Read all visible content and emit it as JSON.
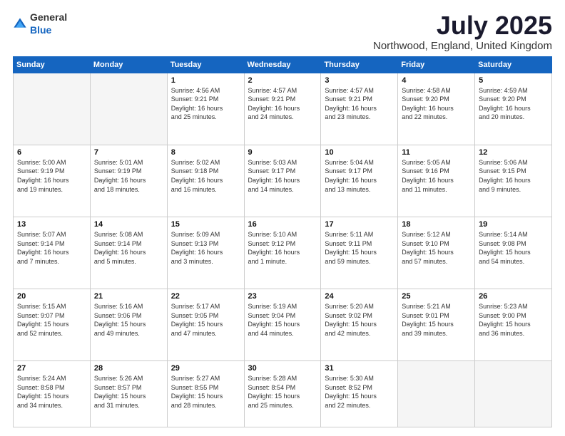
{
  "header": {
    "logo_general": "General",
    "logo_blue": "Blue",
    "title": "July 2025",
    "subtitle": "Northwood, England, United Kingdom"
  },
  "calendar": {
    "days_of_week": [
      "Sunday",
      "Monday",
      "Tuesday",
      "Wednesday",
      "Thursday",
      "Friday",
      "Saturday"
    ],
    "weeks": [
      [
        {
          "day": "",
          "info": ""
        },
        {
          "day": "",
          "info": ""
        },
        {
          "day": "1",
          "info": "Sunrise: 4:56 AM\nSunset: 9:21 PM\nDaylight: 16 hours\nand 25 minutes."
        },
        {
          "day": "2",
          "info": "Sunrise: 4:57 AM\nSunset: 9:21 PM\nDaylight: 16 hours\nand 24 minutes."
        },
        {
          "day": "3",
          "info": "Sunrise: 4:57 AM\nSunset: 9:21 PM\nDaylight: 16 hours\nand 23 minutes."
        },
        {
          "day": "4",
          "info": "Sunrise: 4:58 AM\nSunset: 9:20 PM\nDaylight: 16 hours\nand 22 minutes."
        },
        {
          "day": "5",
          "info": "Sunrise: 4:59 AM\nSunset: 9:20 PM\nDaylight: 16 hours\nand 20 minutes."
        }
      ],
      [
        {
          "day": "6",
          "info": "Sunrise: 5:00 AM\nSunset: 9:19 PM\nDaylight: 16 hours\nand 19 minutes."
        },
        {
          "day": "7",
          "info": "Sunrise: 5:01 AM\nSunset: 9:19 PM\nDaylight: 16 hours\nand 18 minutes."
        },
        {
          "day": "8",
          "info": "Sunrise: 5:02 AM\nSunset: 9:18 PM\nDaylight: 16 hours\nand 16 minutes."
        },
        {
          "day": "9",
          "info": "Sunrise: 5:03 AM\nSunset: 9:17 PM\nDaylight: 16 hours\nand 14 minutes."
        },
        {
          "day": "10",
          "info": "Sunrise: 5:04 AM\nSunset: 9:17 PM\nDaylight: 16 hours\nand 13 minutes."
        },
        {
          "day": "11",
          "info": "Sunrise: 5:05 AM\nSunset: 9:16 PM\nDaylight: 16 hours\nand 11 minutes."
        },
        {
          "day": "12",
          "info": "Sunrise: 5:06 AM\nSunset: 9:15 PM\nDaylight: 16 hours\nand 9 minutes."
        }
      ],
      [
        {
          "day": "13",
          "info": "Sunrise: 5:07 AM\nSunset: 9:14 PM\nDaylight: 16 hours\nand 7 minutes."
        },
        {
          "day": "14",
          "info": "Sunrise: 5:08 AM\nSunset: 9:14 PM\nDaylight: 16 hours\nand 5 minutes."
        },
        {
          "day": "15",
          "info": "Sunrise: 5:09 AM\nSunset: 9:13 PM\nDaylight: 16 hours\nand 3 minutes."
        },
        {
          "day": "16",
          "info": "Sunrise: 5:10 AM\nSunset: 9:12 PM\nDaylight: 16 hours\nand 1 minute."
        },
        {
          "day": "17",
          "info": "Sunrise: 5:11 AM\nSunset: 9:11 PM\nDaylight: 15 hours\nand 59 minutes."
        },
        {
          "day": "18",
          "info": "Sunrise: 5:12 AM\nSunset: 9:10 PM\nDaylight: 15 hours\nand 57 minutes."
        },
        {
          "day": "19",
          "info": "Sunrise: 5:14 AM\nSunset: 9:08 PM\nDaylight: 15 hours\nand 54 minutes."
        }
      ],
      [
        {
          "day": "20",
          "info": "Sunrise: 5:15 AM\nSunset: 9:07 PM\nDaylight: 15 hours\nand 52 minutes."
        },
        {
          "day": "21",
          "info": "Sunrise: 5:16 AM\nSunset: 9:06 PM\nDaylight: 15 hours\nand 49 minutes."
        },
        {
          "day": "22",
          "info": "Sunrise: 5:17 AM\nSunset: 9:05 PM\nDaylight: 15 hours\nand 47 minutes."
        },
        {
          "day": "23",
          "info": "Sunrise: 5:19 AM\nSunset: 9:04 PM\nDaylight: 15 hours\nand 44 minutes."
        },
        {
          "day": "24",
          "info": "Sunrise: 5:20 AM\nSunset: 9:02 PM\nDaylight: 15 hours\nand 42 minutes."
        },
        {
          "day": "25",
          "info": "Sunrise: 5:21 AM\nSunset: 9:01 PM\nDaylight: 15 hours\nand 39 minutes."
        },
        {
          "day": "26",
          "info": "Sunrise: 5:23 AM\nSunset: 9:00 PM\nDaylight: 15 hours\nand 36 minutes."
        }
      ],
      [
        {
          "day": "27",
          "info": "Sunrise: 5:24 AM\nSunset: 8:58 PM\nDaylight: 15 hours\nand 34 minutes."
        },
        {
          "day": "28",
          "info": "Sunrise: 5:26 AM\nSunset: 8:57 PM\nDaylight: 15 hours\nand 31 minutes."
        },
        {
          "day": "29",
          "info": "Sunrise: 5:27 AM\nSunset: 8:55 PM\nDaylight: 15 hours\nand 28 minutes."
        },
        {
          "day": "30",
          "info": "Sunrise: 5:28 AM\nSunset: 8:54 PM\nDaylight: 15 hours\nand 25 minutes."
        },
        {
          "day": "31",
          "info": "Sunrise: 5:30 AM\nSunset: 8:52 PM\nDaylight: 15 hours\nand 22 minutes."
        },
        {
          "day": "",
          "info": ""
        },
        {
          "day": "",
          "info": ""
        }
      ]
    ]
  }
}
